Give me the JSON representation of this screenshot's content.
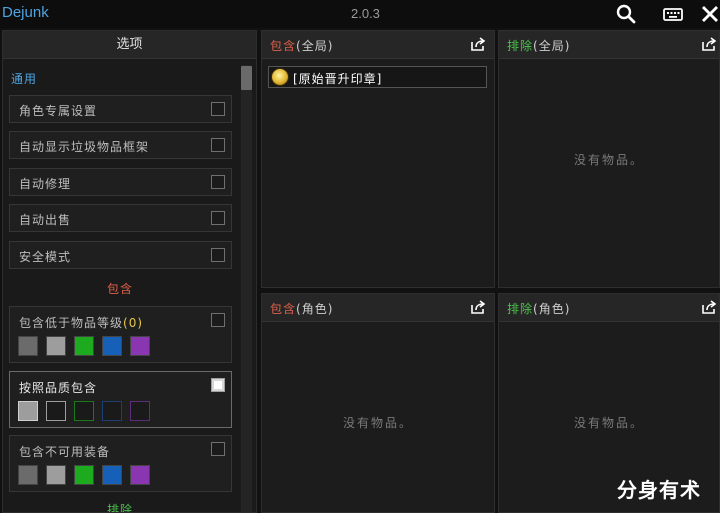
{
  "app": {
    "title": "Dejunk",
    "version": "2.0.3"
  },
  "titlebar_icons": [
    "search-icon",
    "keyboard-icon",
    "close-icon"
  ],
  "colors": {
    "accent": "#4fa3e0",
    "include": "#e0604a",
    "exclude": "#4cc24c",
    "section_general": "#4fa3e0"
  },
  "options": {
    "header": "选项",
    "general_title": "通用",
    "general_items": [
      {
        "label": "角色专属设置",
        "checked": false
      },
      {
        "label": "自动显示垃圾物品框架",
        "checked": false
      },
      {
        "label": "自动修理",
        "checked": false
      },
      {
        "label": "自动出售",
        "checked": false
      },
      {
        "label": "安全模式",
        "checked": false
      }
    ],
    "include_title": "包含",
    "include_below_level": {
      "label": "包含低于物品等级",
      "value": "(0)",
      "checked": false
    },
    "include_by_quality": {
      "label": "按照品质包含",
      "checked": true
    },
    "include_unusable": {
      "label": "包含不可用装备",
      "checked": false
    },
    "exclude_title": "排除",
    "quality_colors": [
      "#6b6b6b",
      "#9d9d9d",
      "#1eaa1e",
      "#1660b8",
      "#8a36b0"
    ]
  },
  "panels": {
    "include_global": {
      "title_a": "包含",
      "title_b": "(全局)",
      "items": [
        {
          "name": "[原始晋升印章]"
        }
      ]
    },
    "exclude_global": {
      "title_a": "排除",
      "title_b": "(全局)",
      "empty": "没有物品。"
    },
    "include_char": {
      "title_a": "包含",
      "title_b": "(角色)",
      "empty": "没有物品。"
    },
    "exclude_char": {
      "title_a": "排除",
      "title_b": "(角色)",
      "empty": "没有物品。"
    }
  },
  "watermark": "分身有术"
}
